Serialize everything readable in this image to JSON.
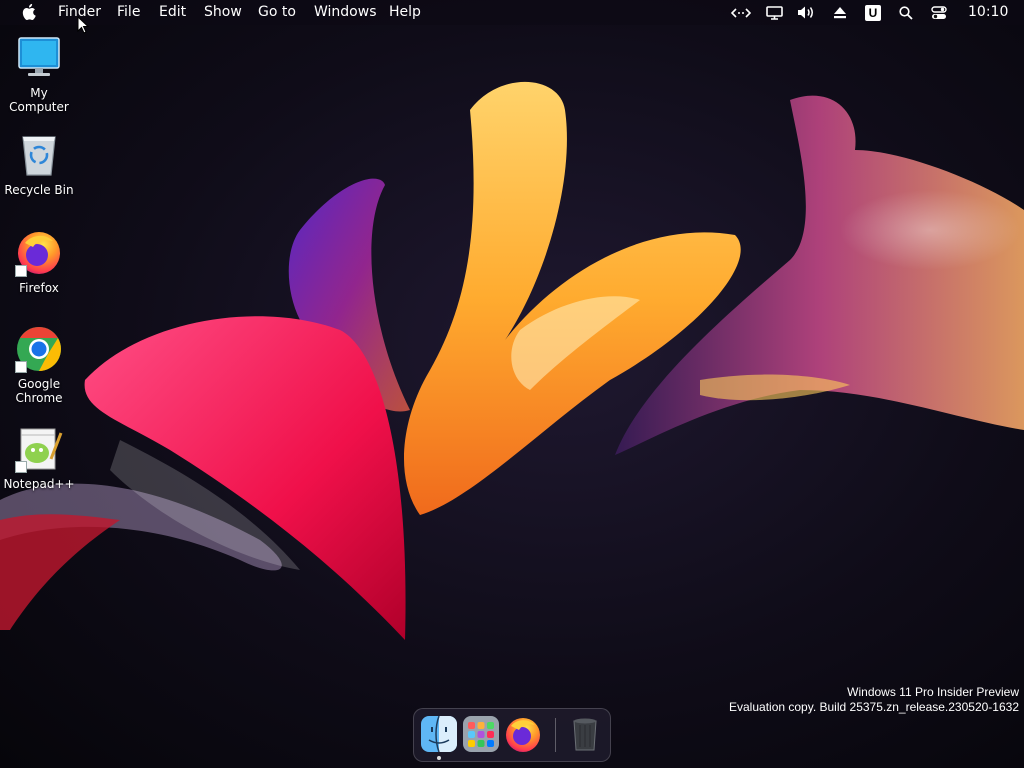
{
  "menubar": {
    "apple_icon": "apple-icon",
    "items": [
      "Finder",
      "File",
      "Edit",
      "Show",
      "Go to",
      "Windows",
      "Help"
    ],
    "status_icons": [
      "code-arrows-icon",
      "display-icon",
      "volume-icon",
      "eject-icon",
      "u-badge-icon",
      "search-icon",
      "control-center-icon"
    ],
    "u_badge": "U",
    "clock": "10:10"
  },
  "desktop": {
    "icons": [
      {
        "label": "My Computer",
        "icon": "monitor-icon"
      },
      {
        "label": "Recycle Bin",
        "icon": "recycle-bin-icon"
      },
      {
        "label": "Firefox",
        "icon": "firefox-icon"
      },
      {
        "label": "Google Chrome",
        "icon": "chrome-icon"
      },
      {
        "label": "Notepad++",
        "icon": "notepadpp-icon"
      }
    ]
  },
  "watermark": {
    "line1": "Windows 11 Pro Insider Preview",
    "line2": "Evaluation copy. Build 25375.zn_release.230520-1632"
  },
  "dock": {
    "items": [
      "finder-icon",
      "launchpad-icon",
      "firefox-icon",
      "trash-icon"
    ]
  },
  "colors": {
    "background": "#0f0c18",
    "menubar": "#0c0a14",
    "accent_pink": "#ff2d6e",
    "accent_orange": "#ffa52a"
  }
}
